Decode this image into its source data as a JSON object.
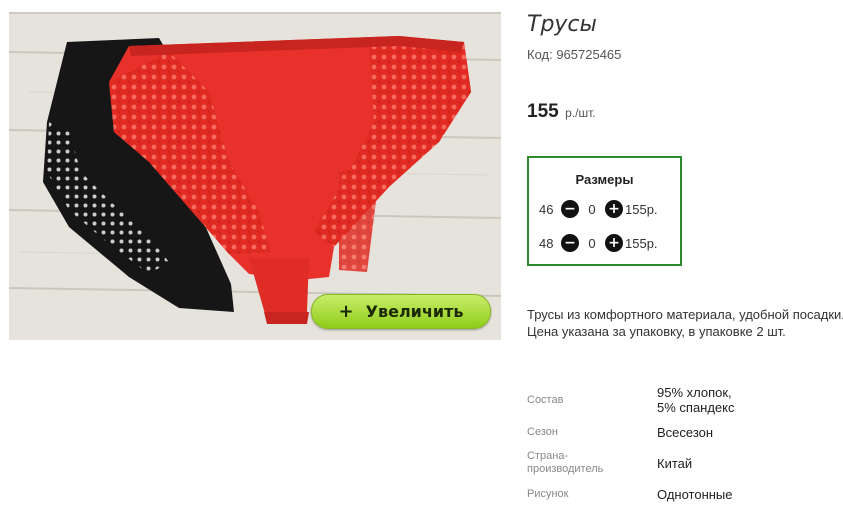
{
  "product": {
    "title": "Трусы",
    "sku": "Код: 965725465",
    "price": "155",
    "price_unit": "р./шт.",
    "image_alt": "lace-panties-photo",
    "zoom_label": "Увеличить",
    "zoom_icon": "+"
  },
  "sizes": {
    "header": "Размеры",
    "rows": [
      {
        "size": "46",
        "qty": "0",
        "price": "155р."
      },
      {
        "size": "48",
        "qty": "0",
        "price": "155р."
      }
    ],
    "minus_icon": "−",
    "plus_icon": "+"
  },
  "description": "Трусы из комфортного материала, удобной посадки. Цена указана за упаковку, в упаковке 2 шт.",
  "properties": [
    {
      "key": "Состав",
      "value_lines": [
        "95% хлопок,",
        "5% спандекс"
      ]
    },
    {
      "key": "Сезон",
      "value_lines": [
        "Всесезон"
      ]
    },
    {
      "key_lines": [
        "Страна-",
        "производитель"
      ],
      "value_lines": [
        "Китай"
      ]
    },
    {
      "key": "Рисунок",
      "value_lines": [
        "Однотонные"
      ]
    }
  ],
  "colors": {
    "accent_border": "#2e8b2e",
    "zoom_button": "#a6dc35",
    "garment_red": "#e8312a",
    "garment_black": "#161616"
  }
}
